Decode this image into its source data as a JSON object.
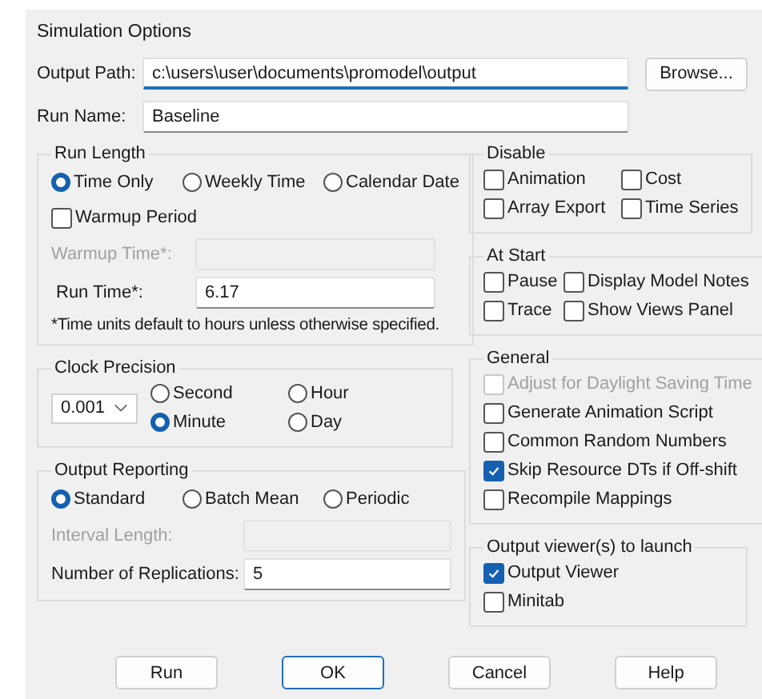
{
  "window": {
    "title": "Simulation Options"
  },
  "output_path": {
    "label": "Output Path:",
    "value": "c:\\users\\user\\documents\\promodel\\output",
    "focused": true
  },
  "browse_button": {
    "label": "Browse..."
  },
  "run_name": {
    "label": "Run Name:",
    "value": "Baseline"
  },
  "run_length": {
    "title": "Run Length",
    "options": [
      {
        "label": "Time Only",
        "selected": true
      },
      {
        "label": "Weekly Time",
        "selected": false
      },
      {
        "label": "Calendar Date",
        "selected": false
      }
    ],
    "warmup_period": {
      "label": "Warmup Period",
      "checked": false
    },
    "warmup_time": {
      "label": "Warmup Time*:",
      "disabled": true
    },
    "run_time": {
      "label": "Run Time*:",
      "value": "6.17",
      "disabled": false
    },
    "note": "*Time units default to hours unless otherwise specified."
  },
  "clock_precision": {
    "title": "Clock Precision",
    "dropdown": {
      "value": "0.001"
    },
    "options": [
      {
        "label": "Second",
        "selected": false
      },
      {
        "label": "Hour",
        "selected": false
      },
      {
        "label": "Minute",
        "selected": true
      },
      {
        "label": "Day",
        "selected": false
      }
    ]
  },
  "output_reporting": {
    "title": "Output Reporting",
    "options": [
      {
        "label": "Standard",
        "selected": true
      },
      {
        "label": "Batch Mean",
        "selected": false
      },
      {
        "label": "Periodic",
        "selected": false
      }
    ],
    "interval_length": {
      "label": "Interval Length:",
      "disabled": true
    },
    "replications": {
      "label": "Number of Replications:",
      "value": "5",
      "disabled": false
    }
  },
  "disable": {
    "title": "Disable",
    "items": [
      {
        "label": "Animation",
        "checked": false
      },
      {
        "label": "Cost",
        "checked": false
      },
      {
        "label": "Array Export",
        "checked": false
      },
      {
        "label": "Time Series",
        "checked": false
      }
    ]
  },
  "at_start": {
    "title": "At Start",
    "items": [
      {
        "label": "Pause",
        "checked": false
      },
      {
        "label": "Display Model Notes",
        "checked": false
      },
      {
        "label": "Trace",
        "checked": false
      },
      {
        "label": "Show Views Panel",
        "checked": false
      }
    ]
  },
  "general": {
    "title": "General",
    "items": [
      {
        "label": "Adjust for Daylight Saving Time",
        "checked": false,
        "disabled": true
      },
      {
        "label": "Generate Animation Script",
        "checked": false,
        "disabled": false
      },
      {
        "label": "Common Random Numbers",
        "checked": false,
        "disabled": false
      },
      {
        "label": "Skip Resource DTs if Off-shift",
        "checked": true,
        "disabled": false
      },
      {
        "label": "Recompile Mappings",
        "checked": false,
        "disabled": false
      }
    ]
  },
  "output_viewers": {
    "title": "Output viewer(s) to launch",
    "items": [
      {
        "label": "Output Viewer",
        "checked": true
      },
      {
        "label": "Minitab",
        "checked": false
      }
    ]
  },
  "buttons": [
    {
      "label": "Run",
      "default": false
    },
    {
      "label": "OK",
      "default": true
    },
    {
      "label": "Cancel",
      "default": false
    },
    {
      "label": "Help",
      "default": false
    }
  ]
}
